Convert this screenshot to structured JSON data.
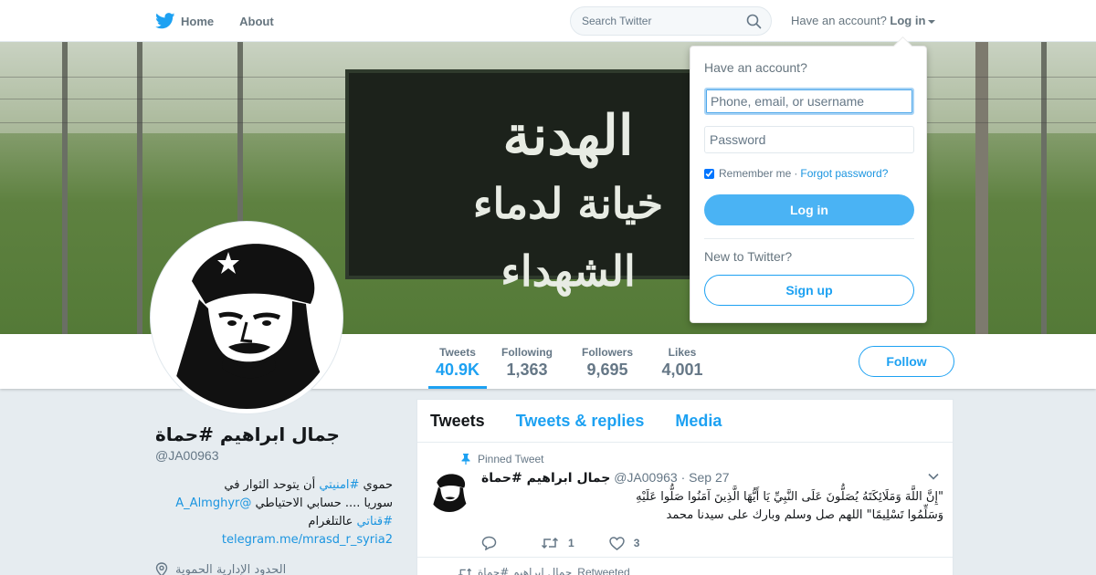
{
  "topnav": {
    "home_label": "Home",
    "about_label": "About",
    "search_placeholder": "Search Twitter",
    "have_account": "Have an account?",
    "login_label": "Log in"
  },
  "banner": {
    "sign_line1": "الهدنة",
    "sign_line2": "خيانة لدماء الشهداء"
  },
  "stats": [
    {
      "label": "Tweets",
      "value": "40.9K"
    },
    {
      "label": "Following",
      "value": "1,363"
    },
    {
      "label": "Followers",
      "value": "9,695"
    },
    {
      "label": "Likes",
      "value": "4,001"
    }
  ],
  "follow_label": "Follow",
  "profile": {
    "name": "جمال ابراهيم #حماة",
    "handle": "@JA00963",
    "bio_line1_pre": "حموي ",
    "bio_hashtag1": "#امنيتي",
    "bio_line1_post": " أن يتوحد الثوار في",
    "bio_line2_pre": "سوريا .... حسابي الاحتياطي ",
    "bio_mention": "@A_Almghyr",
    "bio_line3_pre": "",
    "bio_hashtag2": "#قناتي",
    "bio_line3_post": " عالتلغرام",
    "bio_link": "telegram.me/mrasd_r_syria2",
    "location": "الحدود الإدارية الحموية"
  },
  "timeline": {
    "tabs": [
      "Tweets",
      "Tweets & replies",
      "Media"
    ],
    "pinned_label": "Pinned Tweet",
    "tweet": {
      "name": "جمال ابراهيم #حماة",
      "handle": "@JA00963",
      "sep": "·",
      "date": "Sep 27",
      "text_line1": "\"إِنَّ اللَّهَ وَمَلَائِكَتَهُ يُصَلُّونَ عَلَى النَّبِيِّ يَا أَيُّهَا الَّذِينَ آمَنُوا صَلُّوا عَلَيْهِ",
      "text_line2": "وَسَلِّمُوا تَسْلِيمًا\" اللهم صل وسلم وبارك على سيدنا محمد",
      "replies": "",
      "retweets": "1",
      "likes": "3"
    },
    "retweeted_label": "Retweeted",
    "retweeted_by": "جمال ابراهيم #حماة"
  },
  "login_dropdown": {
    "title": "Have an account?",
    "username_placeholder": "Phone, email, or username",
    "password_placeholder": "Password",
    "remember_label": "Remember me",
    "dot": "·",
    "forgot_label": "Forgot password?",
    "login_button": "Log in",
    "new_label": "New to Twitter?",
    "signup_button": "Sign up"
  },
  "colors": {
    "brand_blue": "#1da1f2",
    "link_blue": "#1b95e0",
    "background": "#e6ecf0"
  }
}
